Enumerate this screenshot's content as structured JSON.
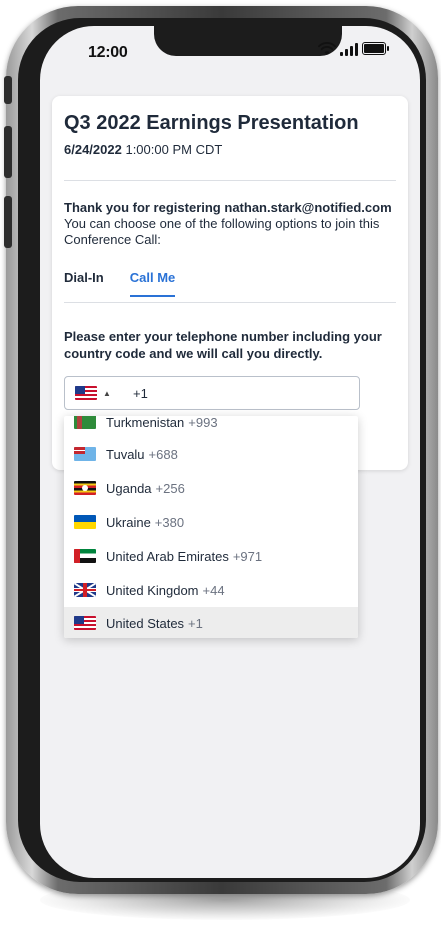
{
  "status_bar": {
    "time": "12:00"
  },
  "event": {
    "title_prefix": "Q3 2022",
    "title_rest": "Earnings Presentation",
    "date": "6/24/2022",
    "time": "1:00:00 PM CDT"
  },
  "registration": {
    "thanks_prefix": "Thank you for registering",
    "email": "nathan.stark@notified.com",
    "instructions": "You can choose one of the following options to join this Conference Call:"
  },
  "tabs": [
    {
      "label": "Dial-In",
      "active": false
    },
    {
      "label": "Call Me",
      "active": true
    }
  ],
  "call_me": {
    "prompt": "Please enter your telephone number including your country code and we will call you directly.",
    "selected_flag": "us-flag-icon",
    "dial_code": "+1"
  },
  "countries": [
    {
      "name": "Turkmenistan",
      "code": "+993",
      "flag": "turkmenistan-flag-icon"
    },
    {
      "name": "Tuvalu",
      "code": "+688",
      "flag": "tuvalu-flag-icon"
    },
    {
      "name": "Uganda",
      "code": "+256",
      "flag": "uganda-flag-icon"
    },
    {
      "name": "Ukraine",
      "code": "+380",
      "flag": "ukraine-flag-icon"
    },
    {
      "name": "United Arab Emirates",
      "code": "+971",
      "flag": "uae-flag-icon"
    },
    {
      "name": "United Kingdom",
      "code": "+44",
      "flag": "uk-flag-icon"
    },
    {
      "name": "United States",
      "code": "+1",
      "flag": "us-flag-icon",
      "selected": true
    }
  ],
  "colors": {
    "accent": "#2a72d6",
    "text": "#1f2a3a"
  }
}
